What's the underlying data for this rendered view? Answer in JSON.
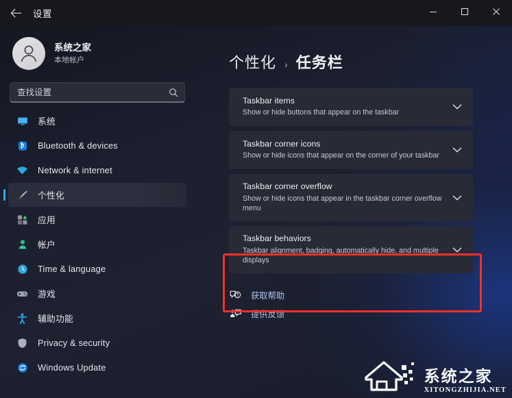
{
  "titlebar": {
    "back_icon": "back-arrow-icon",
    "title": "设置",
    "minimize_label": "—",
    "maximize_label": "□",
    "close_label": "✕"
  },
  "sidebar": {
    "profile": {
      "name": "系统之家",
      "subtitle": "本地帐户",
      "avatar_icon": "user-avatar-icon"
    },
    "search": {
      "placeholder": "查找设置",
      "value": "",
      "icon": "search-icon"
    },
    "items": [
      {
        "label": "系统",
        "icon": "monitor-icon",
        "selected": false
      },
      {
        "label": "Bluetooth & devices",
        "icon": "bluetooth-icon",
        "selected": false
      },
      {
        "label": "Network & internet",
        "icon": "wifi-icon",
        "selected": false
      },
      {
        "label": "个性化",
        "icon": "paintbrush-icon",
        "selected": true
      },
      {
        "label": "应用",
        "icon": "apps-icon",
        "selected": false
      },
      {
        "label": "帐户",
        "icon": "account-icon",
        "selected": false
      },
      {
        "label": "Time & language",
        "icon": "clock-icon",
        "selected": false
      },
      {
        "label": "游戏",
        "icon": "gamepad-icon",
        "selected": false
      },
      {
        "label": "辅助功能",
        "icon": "accessibility-icon",
        "selected": false
      },
      {
        "label": "Privacy & security",
        "icon": "shield-icon",
        "selected": false
      },
      {
        "label": "Windows Update",
        "icon": "update-icon",
        "selected": false
      }
    ]
  },
  "main": {
    "breadcrumb": {
      "parent": "个性化",
      "separator": "›",
      "current": "任务栏"
    },
    "cards": [
      {
        "title": "Taskbar items",
        "subtitle": "Show or hide buttons that appear on the taskbar",
        "chevron": "chevron-down-icon",
        "highlighted": false
      },
      {
        "title": "Taskbar corner icons",
        "subtitle": "Show or hide icons that appear on the corner of your taskbar",
        "chevron": "chevron-down-icon",
        "highlighted": false
      },
      {
        "title": "Taskbar corner overflow",
        "subtitle": "Show or hide icons that appear in the taskbar corner overflow menu",
        "chevron": "chevron-down-icon",
        "highlighted": false
      },
      {
        "title": "Taskbar behaviors",
        "subtitle": "Taskbar alignment, badging, automatically hide, and multiple displays",
        "chevron": "chevron-down-icon",
        "highlighted": true
      }
    ],
    "links": [
      {
        "label": "获取帮助",
        "icon": "help-icon"
      },
      {
        "label": "提供反馈",
        "icon": "feedback-icon"
      }
    ]
  },
  "annotation": {
    "highlight_color": "#f4302a",
    "target": "Taskbar behaviors"
  },
  "watermark": {
    "cn": "系统之家",
    "en": "XITONGZHIJIA.NET",
    "logo_icon": "xitongzhijia-logo-icon"
  }
}
